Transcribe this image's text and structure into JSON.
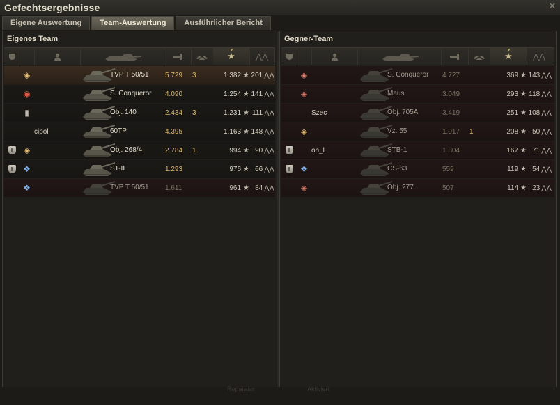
{
  "window": {
    "title": "Gefechtsergebnisse"
  },
  "tabs": [
    {
      "label": "Eigene Auswertung",
      "active": false
    },
    {
      "label": "Team-Auswertung",
      "active": true
    },
    {
      "label": "Ausführlicher Bericht",
      "active": false
    }
  ],
  "own_team": {
    "title": "Eigenes Team",
    "rows": [
      {
        "platoon": "",
        "rank": "gold",
        "player": "",
        "tank": "TVP T 50/51",
        "damage": "5.729",
        "frags": "3",
        "xp": "1.382",
        "points": "201",
        "state": "mine"
      },
      {
        "platoon": "",
        "rank": "red",
        "player": "",
        "tank": "S. Conqueror",
        "damage": "4.090",
        "frags": "",
        "xp": "1.254",
        "points": "141",
        "state": "alive"
      },
      {
        "platoon": "",
        "rank": "silver",
        "player": "",
        "tank": "Obj. 140",
        "damage": "2.434",
        "frags": "3",
        "xp": "1.231",
        "points": "111",
        "state": "alive"
      },
      {
        "platoon": "",
        "rank": "",
        "player": "cipol",
        "tank": "60TP",
        "damage": "4.395",
        "frags": "",
        "xp": "1.163",
        "points": "148",
        "state": "alive"
      },
      {
        "platoon": "I",
        "rank": "gold",
        "player": "",
        "tank": "Obj. 268/4",
        "damage": "2.784",
        "frags": "1",
        "xp": "994",
        "points": "90",
        "state": "alive"
      },
      {
        "platoon": "I",
        "rank": "blue",
        "player": "",
        "tank": "ST-II",
        "damage": "1.293",
        "frags": "",
        "xp": "976",
        "points": "66",
        "state": "alive"
      },
      {
        "platoon": "",
        "rank": "blue",
        "player": "",
        "tank": "TVP T 50/51",
        "damage": "1.611",
        "frags": "",
        "xp": "961",
        "points": "84",
        "state": "dead"
      }
    ]
  },
  "enemy_team": {
    "title": "Gegner-Team",
    "rows": [
      {
        "platoon": "",
        "rank": "pink",
        "player": "",
        "tank": "S. Conqueror",
        "damage": "4.727",
        "frags": "",
        "xp": "369",
        "points": "143",
        "state": "dead"
      },
      {
        "platoon": "",
        "rank": "pink",
        "player": "",
        "tank": "Maus",
        "damage": "3.049",
        "frags": "",
        "xp": "293",
        "points": "118",
        "state": "dead"
      },
      {
        "platoon": "",
        "rank": "",
        "player": "Szec",
        "tank": "Obj. 705A",
        "damage": "3.419",
        "frags": "",
        "xp": "251",
        "points": "108",
        "state": "dead"
      },
      {
        "platoon": "",
        "rank": "gold",
        "player": "",
        "tank": "Vz. 55",
        "damage": "1.017",
        "frags": "1",
        "xp": "208",
        "points": "50",
        "state": "dead"
      },
      {
        "platoon": "I",
        "rank": "",
        "player": "oh_l",
        "tank": "STB-1",
        "damage": "1.804",
        "frags": "",
        "xp": "167",
        "points": "71",
        "state": "dead"
      },
      {
        "platoon": "I",
        "rank": "blue",
        "player": "",
        "tank": "CS-63",
        "damage": "559",
        "frags": "",
        "xp": "119",
        "points": "54",
        "state": "dead"
      },
      {
        "platoon": "",
        "rank": "pink",
        "player": "",
        "tank": "Obj. 277",
        "damage": "507",
        "frags": "",
        "xp": "114",
        "points": "23",
        "state": "dead"
      }
    ]
  },
  "footer": {
    "left_button": "Reparatur",
    "right_button": "Aktiviert"
  },
  "colors": {
    "damage": "#d8b66a",
    "background": "#1c1b17",
    "active_tab": "#6e6a5d"
  },
  "icons": {
    "xp": "star-icon",
    "points": "laurel-icon",
    "rank": "rank-badge-icon",
    "platoon": "platoon-shield-icon"
  }
}
